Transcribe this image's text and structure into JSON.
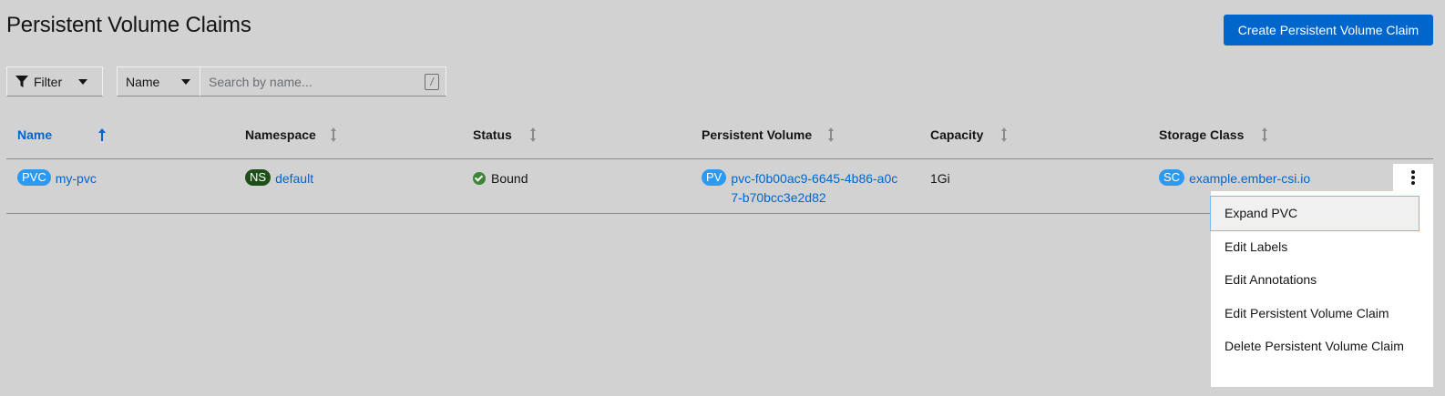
{
  "page": {
    "title": "Persistent Volume Claims",
    "create_button": "Create Persistent Volume Claim"
  },
  "toolbar": {
    "filter_label": "Filter",
    "filter_icon": "filter-icon",
    "name_select": "Name",
    "search_placeholder": "Search by name...",
    "search_shortcut": "/"
  },
  "table": {
    "columns": [
      {
        "label": "Name",
        "sort": "ascending"
      },
      {
        "label": "Namespace",
        "sort": "none"
      },
      {
        "label": "Status",
        "sort": "none"
      },
      {
        "label": "Persistent Volume",
        "sort": "none"
      },
      {
        "label": "Capacity",
        "sort": "none"
      },
      {
        "label": "Storage Class",
        "sort": "none"
      }
    ],
    "rows": [
      {
        "name_badge": "PVC",
        "name": "my-pvc",
        "namespace_badge": "NS",
        "namespace": "default",
        "status": "Bound",
        "pv_badge": "PV",
        "persistent_volume": "pvc-f0b00ac9-6645-4b86-a0c7-b70bcc3e2d82",
        "capacity": "1Gi",
        "sc_badge": "SC",
        "storage_class": "example.ember-csi.io"
      }
    ]
  },
  "kebab_menu": {
    "items": [
      {
        "label": "Expand PVC",
        "focused": true
      },
      {
        "label": "Edit Labels"
      },
      {
        "label": "Edit Annotations"
      },
      {
        "label": "Edit Persistent Volume Claim"
      },
      {
        "label": "Delete Persistent Volume Claim"
      }
    ]
  },
  "colors": {
    "background": "#d2d2d2",
    "primary": "#0066cc",
    "badge_blue": "#2b9af3",
    "badge_ns": "#1e4f18",
    "status_ok": "#3e8635"
  }
}
